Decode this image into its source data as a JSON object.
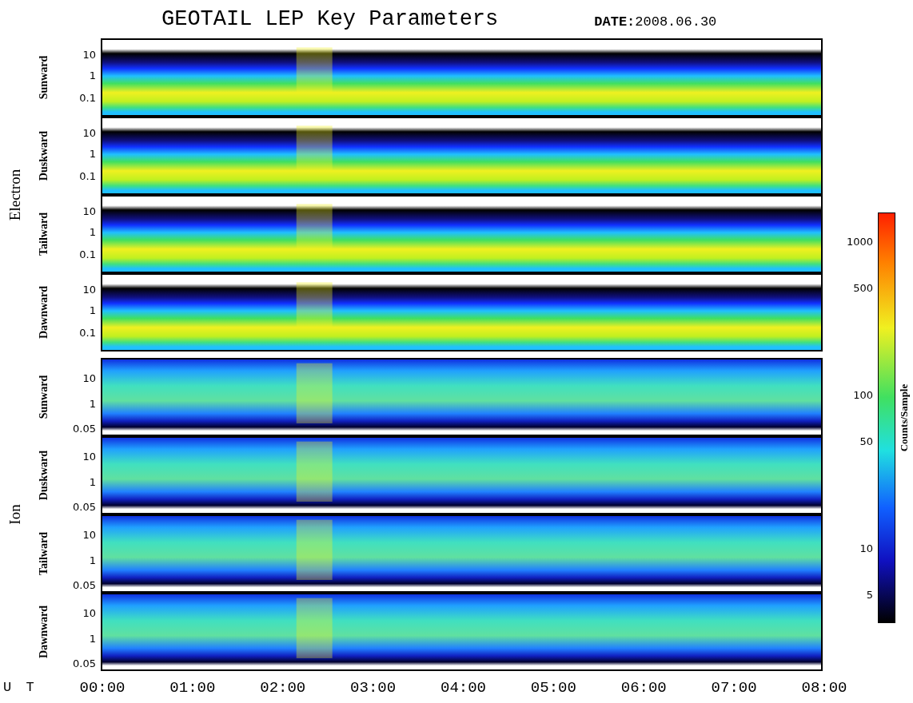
{
  "title": "GEOTAIL LEP Key Parameters",
  "date": {
    "label": "DATE:",
    "value": "2008.06.30"
  },
  "groups": [
    {
      "name": "Electron",
      "kind": "electron",
      "panels": [
        {
          "direction": "Sunward",
          "yticks": [
            "10",
            "1",
            "0.1"
          ]
        },
        {
          "direction": "Duskward",
          "yticks": [
            "10",
            "1",
            "0.1"
          ]
        },
        {
          "direction": "Tailward",
          "yticks": [
            "10",
            "1",
            "0.1"
          ]
        },
        {
          "direction": "Dawnward",
          "yticks": [
            "10",
            "1",
            "0.1"
          ]
        }
      ]
    },
    {
      "name": "Ion",
      "kind": "ion",
      "panels": [
        {
          "direction": "Sunward",
          "yticks": [
            "10",
            "1",
            "0.05"
          ]
        },
        {
          "direction": "Duskward",
          "yticks": [
            "10",
            "1",
            "0.05"
          ]
        },
        {
          "direction": "Tailward",
          "yticks": [
            "10",
            "1",
            "0.05"
          ]
        },
        {
          "direction": "Dawnward",
          "yticks": [
            "10",
            "1",
            "0.05"
          ]
        }
      ]
    }
  ],
  "colorbar": {
    "label": "Counts/Sample",
    "ticks": [
      "1000",
      "500",
      "100",
      "50",
      "10",
      "5"
    ]
  },
  "x_axis": {
    "label": "U T",
    "ticks": [
      "00:00",
      "01:00",
      "02:00",
      "03:00",
      "04:00",
      "05:00",
      "06:00",
      "07:00",
      "08:00"
    ]
  }
}
